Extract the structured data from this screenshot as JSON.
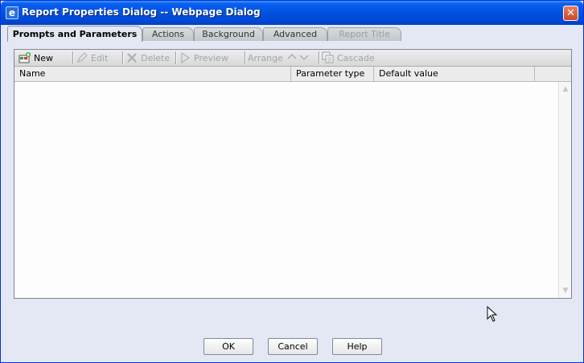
{
  "window": {
    "title": "Report Properties Dialog -- Webpage Dialog",
    "title_icon": "ie-icon",
    "close_label": "✕"
  },
  "tabs": [
    {
      "label": "Prompts and Parameters",
      "state": "active"
    },
    {
      "label": "Actions",
      "state": "normal"
    },
    {
      "label": "Background",
      "state": "normal"
    },
    {
      "label": "Advanced",
      "state": "normal"
    },
    {
      "label": "Report Title",
      "state": "disabled"
    }
  ],
  "toolbar": {
    "new": {
      "label": "New",
      "icon": "new-parameter-icon",
      "enabled": true
    },
    "edit": {
      "label": "Edit",
      "icon": "pencil-icon",
      "enabled": false
    },
    "delete": {
      "label": "Delete",
      "icon": "delete-x-icon",
      "enabled": false
    },
    "preview": {
      "label": "Preview",
      "icon": "play-icon",
      "enabled": false
    },
    "arrange": {
      "label": "Arrange",
      "icons": [
        "arrow-up-icon",
        "arrow-down-icon"
      ],
      "enabled": false
    },
    "cascade": {
      "label": "Cascade",
      "icon": "cascade-icon",
      "enabled": false
    }
  },
  "table": {
    "columns": [
      "Name",
      "Parameter type",
      "Default value"
    ],
    "rows": []
  },
  "buttons": {
    "ok": "OK",
    "cancel": "Cancel",
    "help": "Help"
  },
  "colors": {
    "titlebar": "#0054e3",
    "dialog_background": "#e3e8f4",
    "disabled_text": "#a0a4a8"
  }
}
